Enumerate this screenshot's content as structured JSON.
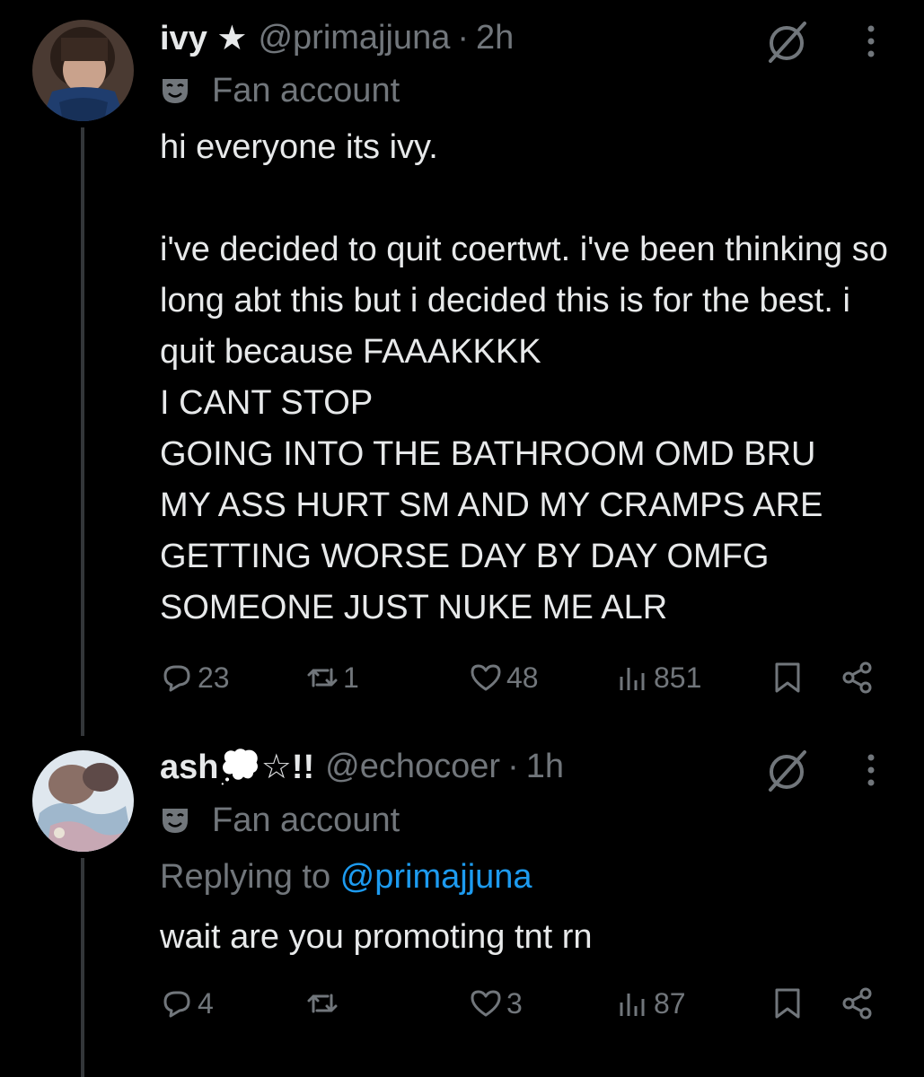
{
  "tweets": [
    {
      "display_name": "ivy ★",
      "handle": "@primajjuna",
      "separator": "·",
      "time": "2h",
      "label": "Fan account",
      "text": "hi everyone its ivy.\n\ni've decided to quit coertwt. i've been thinking so long abt this but i decided this is for the best. i quit because FAAAKKKK\nI CANT STOP\nGOING INTO THE BATHROOM OMD BRU\nMY ASS HURT SM AND MY CRAMPS ARE GETTING WORSE DAY BY DAY OMFG\nSOMEONE JUST NUKE ME ALR",
      "replies": "23",
      "retweets": "1",
      "likes": "48",
      "views": "851"
    },
    {
      "display_name": "ash💭☆!!",
      "handle": "@echocoer",
      "separator": "·",
      "time": "1h",
      "label": "Fan account",
      "replying_prefix": "Replying to ",
      "replying_handle": "@primajjuna",
      "text": "wait are you promoting tnt rn",
      "replies": "4",
      "retweets": "",
      "likes": "3",
      "views": "87"
    }
  ],
  "icons": {
    "grok": "grok-slash-icon",
    "more": "more-vertical-icon",
    "label": "parody-mask-icon",
    "reply": "reply-bubble-icon",
    "retweet": "retweet-icon",
    "like": "heart-icon",
    "views": "views-bar-chart-icon",
    "bookmark": "bookmark-icon",
    "share": "share-icon"
  },
  "colors": {
    "background": "#000000",
    "text": "#e7e9ea",
    "secondary": "#71767b",
    "link": "#1d9bf0",
    "thread_line": "#333639"
  }
}
